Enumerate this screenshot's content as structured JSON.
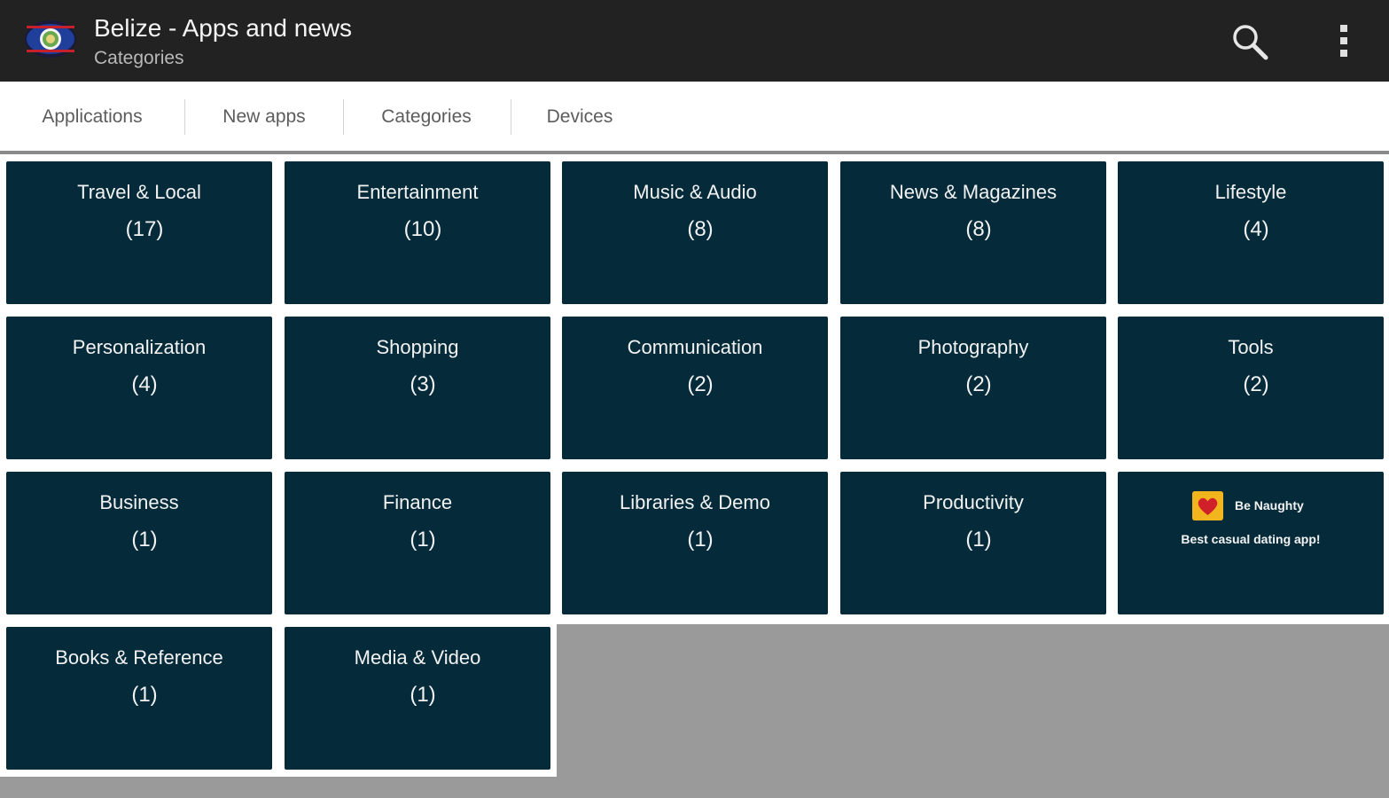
{
  "header": {
    "title": "Belize - Apps and news",
    "subtitle": "Categories",
    "icons": [
      "belize-flag-icon",
      "search-icon",
      "overflow-menu-icon"
    ]
  },
  "tabs": [
    {
      "label": "Applications"
    },
    {
      "label": "New apps"
    },
    {
      "label": "Categories"
    },
    {
      "label": "Devices"
    }
  ],
  "categories": [
    {
      "name": "Travel & Local",
      "count": "(17)"
    },
    {
      "name": "Entertainment",
      "count": "(10)"
    },
    {
      "name": "Music & Audio",
      "count": "(8)"
    },
    {
      "name": "News & Magazines",
      "count": "(8)"
    },
    {
      "name": "Lifestyle",
      "count": "(4)"
    },
    {
      "name": "Personalization",
      "count": "(4)"
    },
    {
      "name": "Shopping",
      "count": "(3)"
    },
    {
      "name": "Communication",
      "count": "(2)"
    },
    {
      "name": "Photography",
      "count": "(2)"
    },
    {
      "name": "Tools",
      "count": "(2)"
    },
    {
      "name": "Business",
      "count": "(1)"
    },
    {
      "name": "Finance",
      "count": "(1)"
    },
    {
      "name": "Libraries & Demo",
      "count": "(1)"
    },
    {
      "name": "Productivity",
      "count": "(1)"
    },
    {
      "name": "Books & Reference",
      "count": "(1)"
    },
    {
      "name": "Media & Video",
      "count": "(1)"
    }
  ],
  "ad": {
    "title": "Be Naughty",
    "description": "Best casual dating app!",
    "icon": "heart-icon"
  },
  "colors": {
    "actionbar": "#222222",
    "tile": "#052b3a",
    "background": "#9a9a9a"
  }
}
